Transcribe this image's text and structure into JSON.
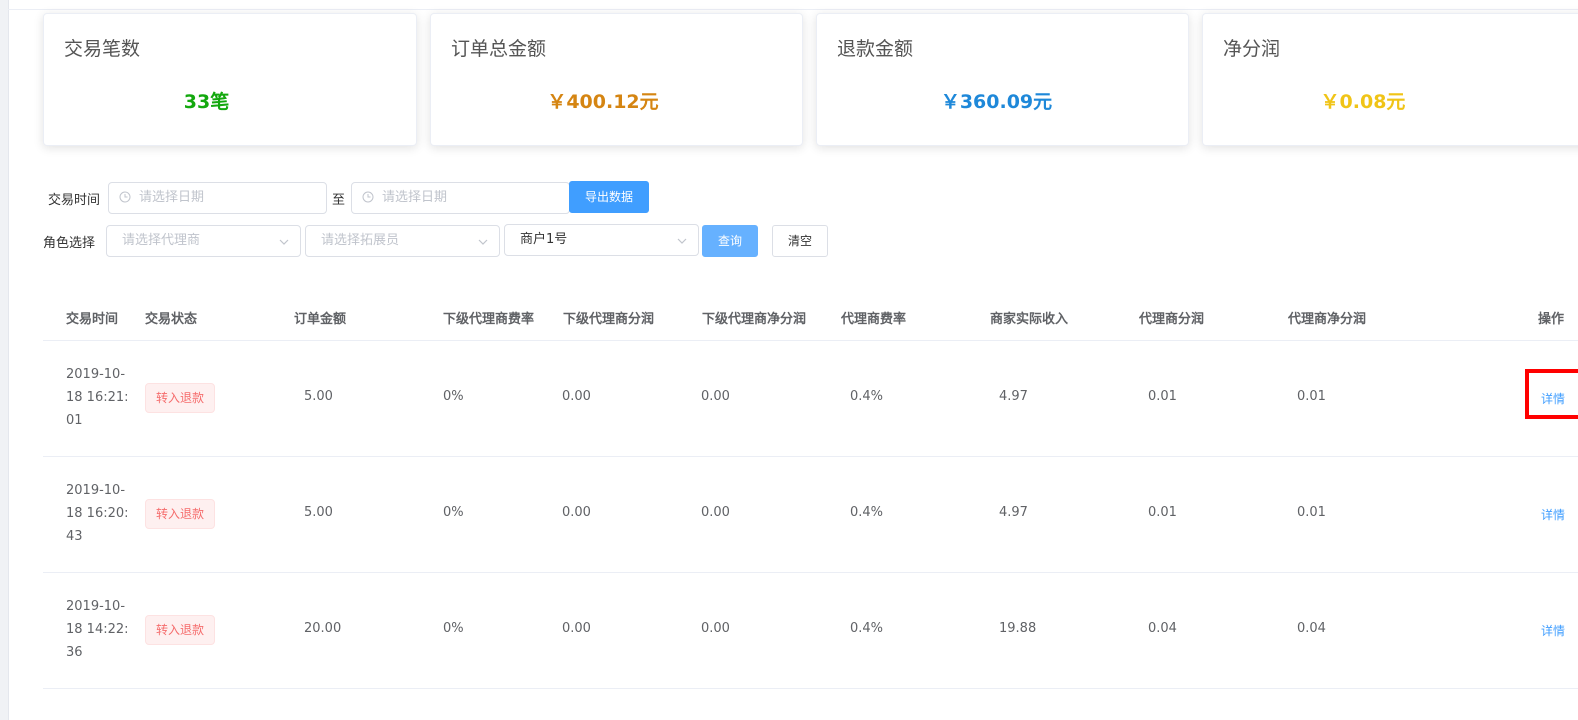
{
  "cards": [
    {
      "title": "交易笔数",
      "value": "33笔",
      "color": "#13a80e"
    },
    {
      "title": "订单总金额",
      "value": "￥400.12元",
      "color": "#d58512"
    },
    {
      "title": "退款金额",
      "value": "￥360.09元",
      "color": "#1e88d9"
    },
    {
      "title": "净分润",
      "value": "￥0.08元",
      "color": "#f0c417"
    }
  ],
  "filters": {
    "time_label": "交易时间",
    "start_placeholder": "请选择日期",
    "to_label": "至",
    "end_placeholder": "请选择日期",
    "export_label": "导出数据",
    "role_label": "角色选择",
    "agent_placeholder": "请选择代理商",
    "promoter_placeholder": "请选择拓展员",
    "merchant_value": "商户1号",
    "query_label": "查询",
    "clear_label": "清空"
  },
  "table": {
    "headers": [
      "交易时间",
      "交易状态",
      "订单金额",
      "下级代理商费率",
      "下级代理商分润",
      "下级代理商净分润",
      "代理商费率",
      "商家实际收入",
      "代理商分润",
      "代理商净分润",
      "操作"
    ],
    "rows": [
      {
        "time": "2019-10-18 16:21:01",
        "status": "转入退款",
        "amount": "5.00",
        "sub_rate": "0%",
        "sub_profit": "0.00",
        "sub_net": "0.00",
        "rate": "0.4%",
        "income": "4.97",
        "profit": "0.01",
        "net": "0.01",
        "action": "详情"
      },
      {
        "time": "2019-10-18 16:20:43",
        "status": "转入退款",
        "amount": "5.00",
        "sub_rate": "0%",
        "sub_profit": "0.00",
        "sub_net": "0.00",
        "rate": "0.4%",
        "income": "4.97",
        "profit": "0.01",
        "net": "0.01",
        "action": "详情"
      },
      {
        "time": "2019-10-18 14:22:36",
        "status": "转入退款",
        "amount": "20.00",
        "sub_rate": "0%",
        "sub_profit": "0.00",
        "sub_net": "0.00",
        "rate": "0.4%",
        "income": "19.88",
        "profit": "0.04",
        "net": "0.04",
        "action": "详情"
      }
    ]
  },
  "icons": {
    "date_icon": "clock-icon",
    "select_icon": "chevron-down-icon"
  }
}
